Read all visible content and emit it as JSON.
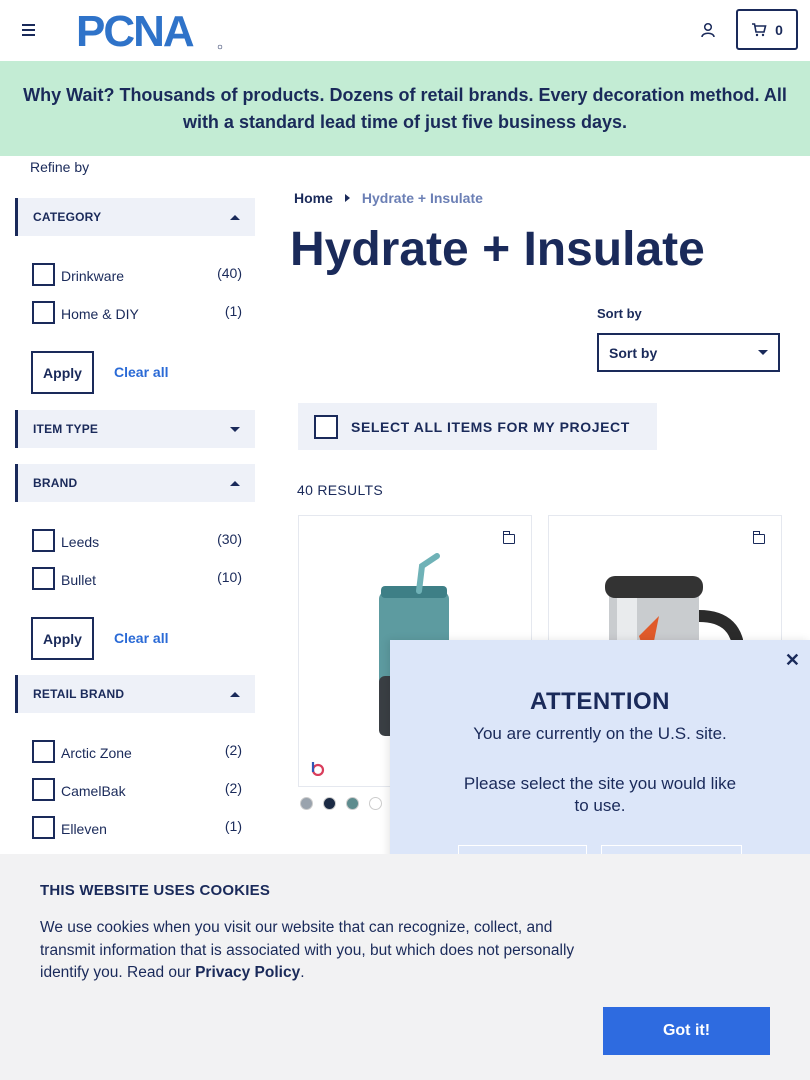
{
  "header": {
    "logo_text": "PCNA",
    "cart_count": "0",
    "icons": [
      "hamburger-icon",
      "user-icon",
      "cart-icon"
    ]
  },
  "promo": {
    "text": "Why Wait? Thousands of products. Dozens of retail brands. Every decoration method. All with a standard lead time of just five business days."
  },
  "sidebar": {
    "refine_label": "Refine by",
    "facets": {
      "category": {
        "title": "CATEGORY",
        "expanded": true,
        "options": [
          {
            "label": "Drinkware",
            "count": "(40)"
          },
          {
            "label": "Home & DIY",
            "count": "(1)"
          }
        ],
        "apply_label": "Apply",
        "clear_label": "Clear all"
      },
      "item_type": {
        "title": "ITEM TYPE",
        "expanded": false
      },
      "brand": {
        "title": "BRAND",
        "expanded": true,
        "options": [
          {
            "label": "Leeds",
            "count": "(30)"
          },
          {
            "label": "Bullet",
            "count": "(10)"
          }
        ],
        "apply_label": "Apply",
        "clear_label": "Clear all"
      },
      "retail_brand": {
        "title": "RETAIL BRAND",
        "expanded": true,
        "options": [
          {
            "label": "Arctic Zone",
            "count": "(2)"
          },
          {
            "label": "CamelBak",
            "count": "(2)"
          },
          {
            "label": "Elleven",
            "count": "(1)"
          }
        ]
      }
    }
  },
  "main": {
    "breadcrumb": {
      "home": "Home",
      "current": "Hydrate + Insulate"
    },
    "title": "Hydrate + Insulate",
    "sort": {
      "label": "Sort by",
      "value": "Sort by"
    },
    "select_all_label": "SELECT ALL ITEMS FOR MY PROJECT",
    "results_label": "40 RESULTS",
    "swatch_colors": [
      "#9aa3ad",
      "#1b2a44",
      "#5e8c8e",
      "#ffffff"
    ]
  },
  "attention": {
    "title": "ATTENTION",
    "line1": "You are currently on the U.S. site.",
    "line2": "Please select the site you would like to use."
  },
  "cookie": {
    "title": "THIS WEBSITE USES COOKIES",
    "body": "We use cookies when you visit our website that can recognize, collect, and transmit information that is associated with you, but which does not personally identify you. Read our ",
    "link": "Privacy Policy",
    "tail": ".",
    "button": "Got it!"
  },
  "colors": {
    "navy": "#1a2a5a",
    "promo_bg": "#c3ecd4",
    "accent_blue": "#2e6be0"
  }
}
